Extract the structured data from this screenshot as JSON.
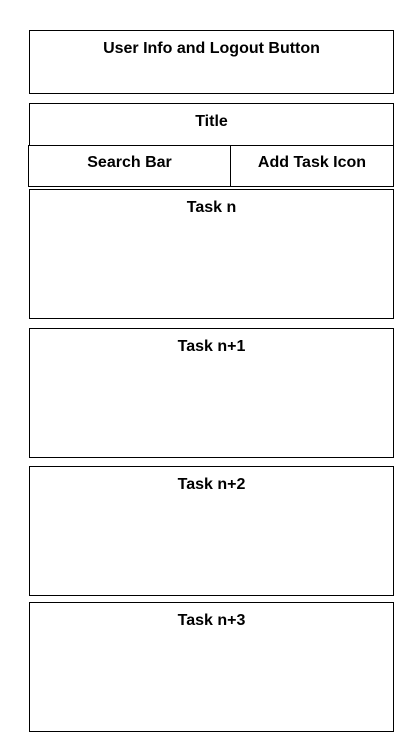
{
  "header": {
    "label": "User Info and Logout Button"
  },
  "title": {
    "label": "Title"
  },
  "search": {
    "label": "Search Bar"
  },
  "add_task": {
    "label": "Add Task Icon"
  },
  "tasks": [
    {
      "label": "Task n"
    },
    {
      "label": "Task n+1"
    },
    {
      "label": "Task n+2"
    },
    {
      "label": "Task n+3"
    }
  ]
}
